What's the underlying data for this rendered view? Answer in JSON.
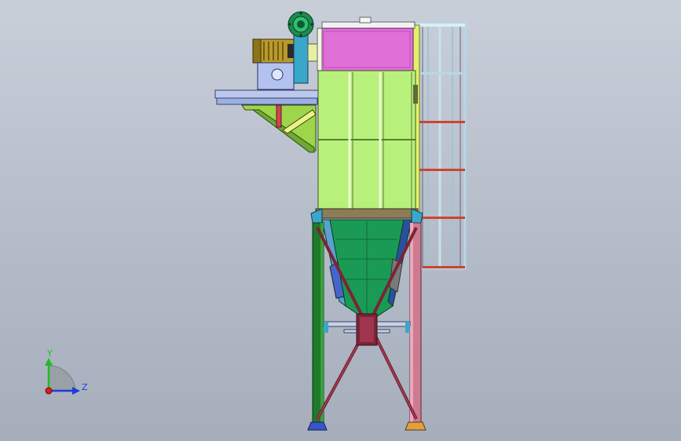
{
  "triad": {
    "y_label": "Y",
    "z_label": "Z",
    "y_color": "#22bb22",
    "z_color": "#1e3cd8",
    "x_color": "#d81e1e"
  },
  "colors": {
    "background_top": "#c9cfd9",
    "background_bottom": "#a6aebb",
    "filter_housing": "#b8f07c",
    "top_chamber": "#e070d8",
    "hopper": "#1a9a55",
    "left_leg": "#1f7a2a",
    "right_leg": "#d07a92",
    "ladder": "#b7d7e6",
    "ladder_rungs": "#d0442a",
    "motor": "#b99a2a",
    "fan": "#3aa6c9",
    "platform": "#9cb0e6",
    "cross_brace": "#7a2436",
    "support_arm": "#9ed54a",
    "base_plate_left": "#3a55c8",
    "base_plate_right": "#e0a040"
  }
}
